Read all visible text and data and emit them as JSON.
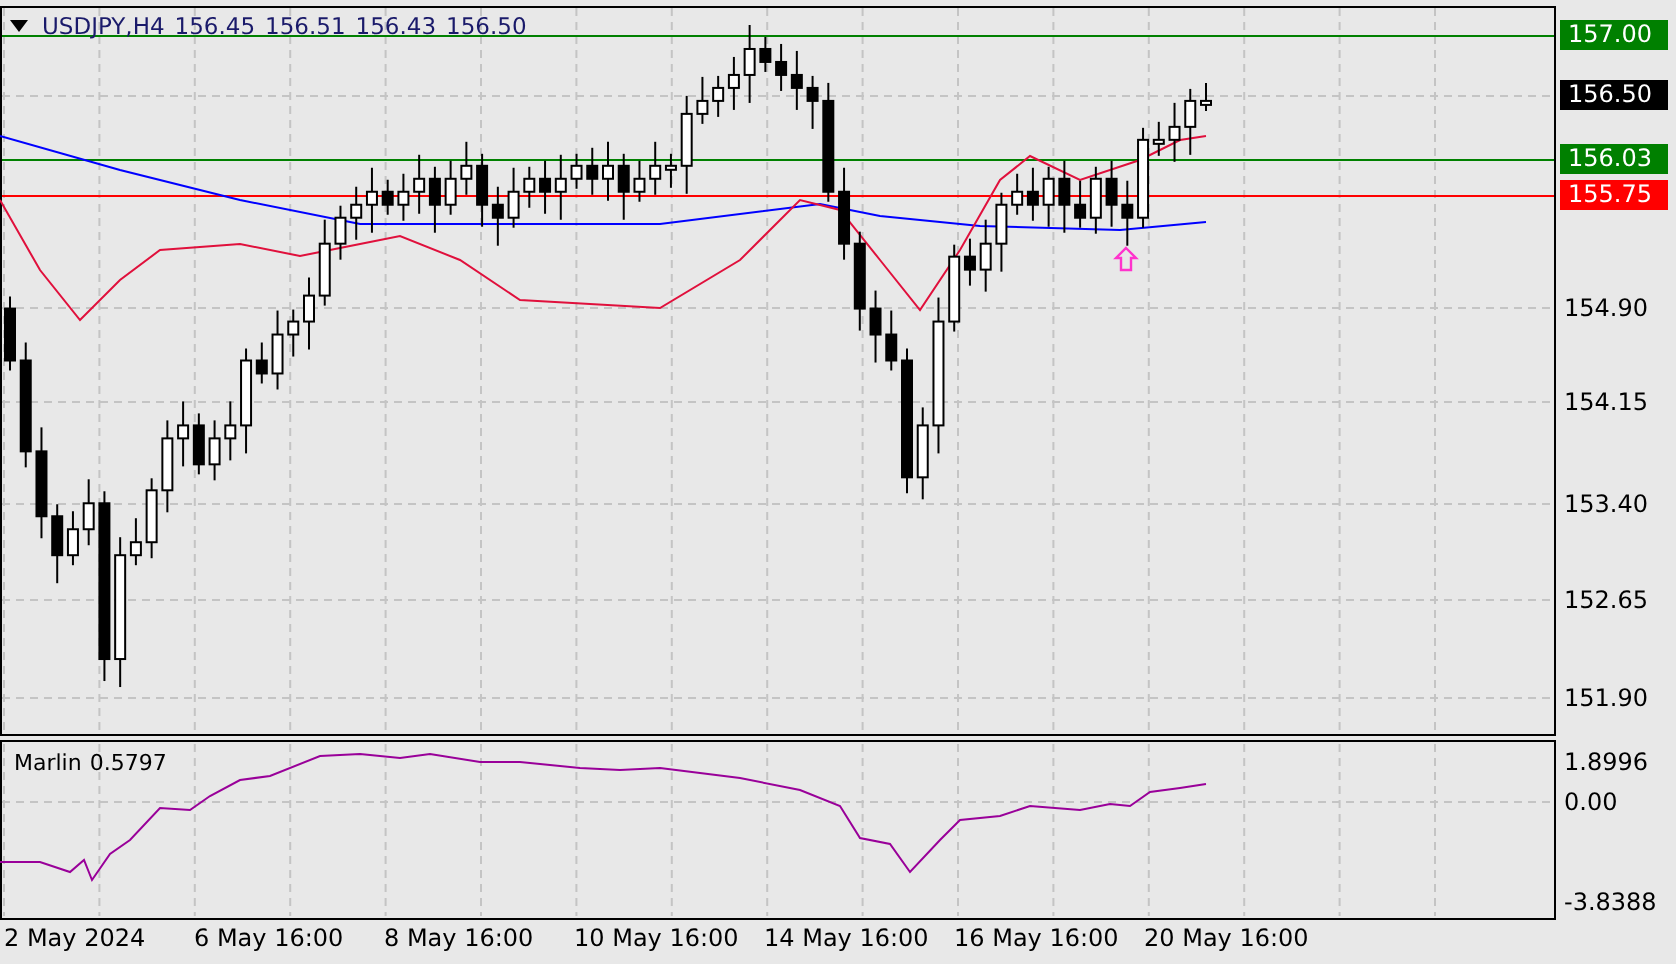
{
  "header": {
    "symbol": "USDJPY,H4",
    "open": "156.45",
    "high": "156.51",
    "low": "156.43",
    "close": "156.50"
  },
  "levels": [
    {
      "label": "157.00",
      "color": "#008000"
    },
    {
      "label": "156.03",
      "color": "#008000"
    },
    {
      "label": "155.75",
      "color": "#ff0000"
    }
  ],
  "current_price": {
    "label": "156.50"
  },
  "price_axis": {
    "ticks": [
      "154.90",
      "154.15",
      "153.40",
      "152.65",
      "151.90"
    ]
  },
  "indicator": {
    "name": "Marlin",
    "value": "0.5797",
    "axis": [
      "1.8996",
      "0.00",
      "-3.8388"
    ]
  },
  "time_axis": [
    "2 May 2024",
    "6 May 16:00",
    "8 May 16:00",
    "10 May 16:00",
    "14 May 16:00",
    "16 May 16:00",
    "20 May 16:00"
  ]
}
